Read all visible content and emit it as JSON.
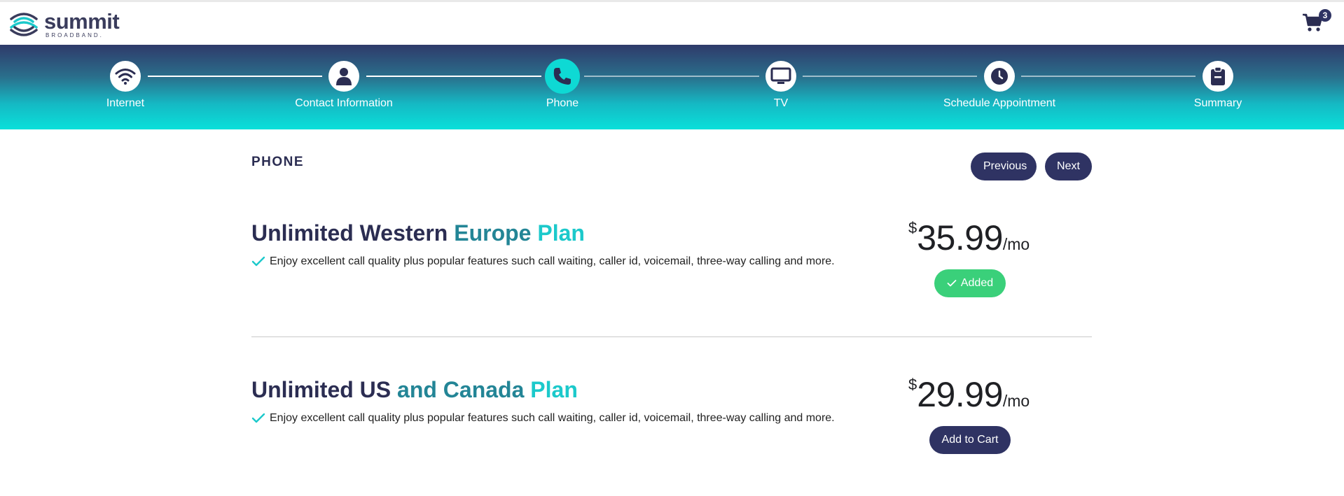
{
  "brand": {
    "name": "summit",
    "sub": "BROADBAND."
  },
  "cart": {
    "count": "3",
    "icon": "cart-icon"
  },
  "steps": [
    {
      "label": "Internet",
      "icon": "wifi-icon",
      "state": "done"
    },
    {
      "label": "Contact Information",
      "icon": "person-icon",
      "state": "done"
    },
    {
      "label": "Phone",
      "icon": "phone-icon",
      "state": "active"
    },
    {
      "label": "TV",
      "icon": "tv-icon",
      "state": "todo"
    },
    {
      "label": "Schedule Appointment",
      "icon": "clock-icon",
      "state": "todo"
    },
    {
      "label": "Summary",
      "icon": "clipboard-icon",
      "state": "todo"
    }
  ],
  "section": {
    "title": "PHONE",
    "prev_label": "Previous",
    "next_label": "Next"
  },
  "plans": [
    {
      "title_w1": "Unlimited Western ",
      "title_w2": "Europe ",
      "title_w3": "Plan",
      "feature": "Enjoy excellent call quality plus popular features such call waiting, caller id, voicemail, three-way calling and more.",
      "currency": "$",
      "amount": "35.99",
      "period": "/mo",
      "button_label": "Added",
      "added": true
    },
    {
      "title_w1": "Unlimited US ",
      "title_w2": "and Canada ",
      "title_w3": "Plan",
      "feature": "Enjoy excellent call quality plus popular features such call waiting, caller id, voicemail, three-way calling and more.",
      "currency": "$",
      "amount": "29.99",
      "period": "/mo",
      "button_label": "Add to Cart",
      "added": false
    }
  ],
  "colors": {
    "navy": "#2f3363",
    "teal": "#0ed9d4",
    "added_green": "#3ad07a"
  }
}
